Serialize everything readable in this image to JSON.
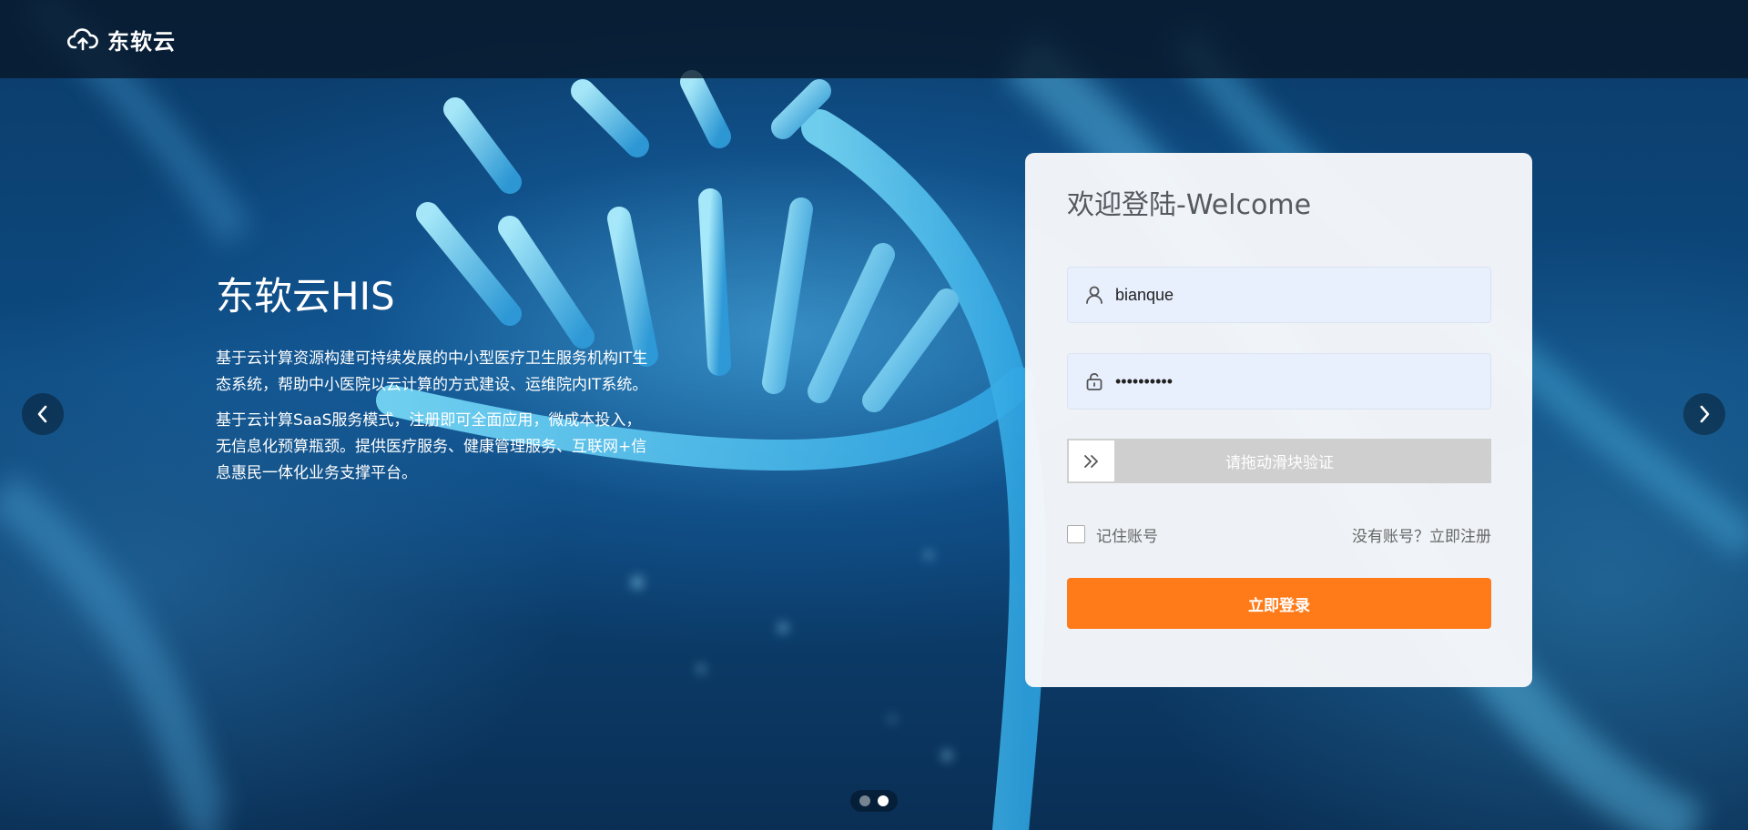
{
  "header": {
    "brand_name": "东软云",
    "brand_icon": "cloud-upload-icon"
  },
  "hero": {
    "title": "东软云HIS",
    "paragraph1": "基于云计算资源构建可持续发展的中小型医疗卫生服务机构IT生态系统，帮助中小医院以云计算的方式建设、运维院内IT系统。",
    "paragraph2": "基于云计算SaaS服务模式，注册即可全面应用，微成本投入，无信息化预算瓶颈。提供医疗服务、健康管理服务、互联网+信息惠民一体化业务支撑平台。"
  },
  "carousel": {
    "prev_icon": "chevron-left-icon",
    "next_icon": "chevron-right-icon",
    "slide_count": 2,
    "active_slide": 2
  },
  "login": {
    "title": "欢迎登陆-Welcome",
    "username_value": "bianque",
    "password_value": "••••••••••",
    "slider_text": "请拖动滑块验证",
    "remember_label": "记住账号",
    "register_text": "没有账号？立即注册",
    "submit_label": "立即登录"
  },
  "colors": {
    "accent": "#ff7b1a",
    "input_bg": "#e8effd",
    "slider_bg": "#cfcfcf"
  }
}
